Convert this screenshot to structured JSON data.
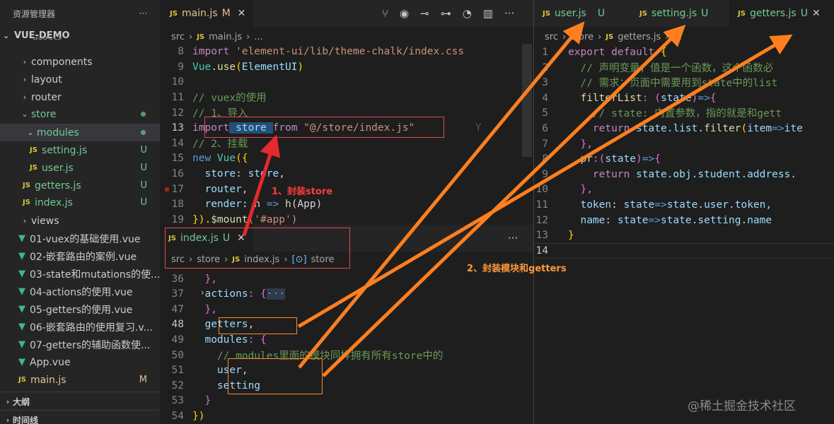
{
  "sidebar": {
    "header": "资源管理器",
    "more": "···",
    "project": "VUE-DEMO",
    "rows": [
      {
        "label": "assets",
        "badge": ""
      },
      {
        "label": "components",
        "badge": ""
      },
      {
        "label": "layout",
        "badge": ""
      },
      {
        "label": "router",
        "badge": ""
      },
      {
        "label": "store",
        "badge": ""
      },
      {
        "label": "modules",
        "badge": ""
      },
      {
        "label": "setting.js",
        "badge": "U"
      },
      {
        "label": "user.js",
        "badge": "U"
      },
      {
        "label": "getters.js",
        "badge": "U"
      },
      {
        "label": "index.js",
        "badge": "U"
      },
      {
        "label": "views",
        "badge": ""
      },
      {
        "label": "01-vuex的基础使用.vue",
        "badge": ""
      },
      {
        "label": "02-嵌套路由的案例.vue",
        "badge": ""
      },
      {
        "label": "03-state和mutations的使...",
        "badge": ""
      },
      {
        "label": "04-actions的使用.vue",
        "badge": ""
      },
      {
        "label": "05-getters的使用.vue",
        "badge": ""
      },
      {
        "label": "06-嵌套路由的使用复习.v...",
        "badge": ""
      },
      {
        "label": "07-getters的辅助函数使...",
        "badge": ""
      },
      {
        "label": "App.vue",
        "badge": ""
      },
      {
        "label": "main.js",
        "badge": "M"
      }
    ],
    "outline": "大纲",
    "timeline": "时间线"
  },
  "left_editor": {
    "tab": {
      "icon": "JS",
      "name": "main.js",
      "status": "M",
      "close": "✕"
    },
    "breadcrumb": [
      "src",
      "main.js",
      "..."
    ],
    "lines": [
      {
        "n": "8"
      },
      {
        "n": "9"
      },
      {
        "n": "10"
      },
      {
        "n": "11"
      },
      {
        "n": "12"
      },
      {
        "n": "13"
      },
      {
        "n": "14"
      },
      {
        "n": "15"
      },
      {
        "n": "16"
      },
      {
        "n": "17"
      },
      {
        "n": "18"
      },
      {
        "n": "19"
      }
    ],
    "code": {
      "l8a": "import",
      "l8b": " 'element-ui/lib/theme-chalk/index.css",
      "l9a": "Vue",
      "l9b": ".",
      "l9c": "use",
      "l9d": "(",
      "l9e": "ElementUI",
      "l9f": ")",
      "l11": "// vuex的使用",
      "l12": "// 1、导入",
      "l13a": "import",
      "l13b": " store ",
      "l13c": "from",
      "l13d": " \"@/store/index.js\"",
      "l13e": "Y",
      "l14": "// 2、挂载",
      "l15a": "new",
      "l15b": " Vue",
      "l15c": "({",
      "l16a": "  store",
      "l16b": ": ",
      "l16c": "store",
      "l16d": ",",
      "l17a": "  router",
      "l17b": ", ",
      "l18a": "  render",
      "l18b": ": h ",
      "l18c": "=>",
      "l18d": " h",
      "l18e": "(App)",
      "l19a": "}).",
      "l19b": "$mount",
      "l19c": "('#app')"
    }
  },
  "bottom_editor": {
    "tab": {
      "icon": "JS",
      "name": "index.js",
      "status": "U",
      "close": "✕"
    },
    "more": "···",
    "breadcrumb": [
      "src",
      "store",
      "index.js",
      "store"
    ],
    "lines": [
      {
        "n": "36"
      },
      {
        "n": "37"
      },
      {
        "n": "47"
      },
      {
        "n": "48"
      },
      {
        "n": "49"
      },
      {
        "n": "50"
      },
      {
        "n": "51"
      },
      {
        "n": "52"
      },
      {
        "n": "53"
      },
      {
        "n": "54"
      }
    ],
    "code": {
      "l36": "  },",
      "l37a": "  actions",
      "l37b": ": {",
      "l37c": "···",
      "l47": "  },",
      "l48a": "  getters",
      "l48b": ",",
      "l49a": "  modules",
      "l49b": ": {",
      "l50": "    // modules里面的模块同样拥有所有store中的",
      "l51a": "    user",
      "l51b": ",",
      "l52": "    setting",
      "l53": "  }",
      "l54": "})"
    }
  },
  "right_editor": {
    "tabs": [
      {
        "icon": "JS",
        "name": "user.js",
        "status": "U"
      },
      {
        "icon": "JS",
        "name": "setting.js",
        "status": "U"
      },
      {
        "icon": "JS",
        "name": "getters.js",
        "status": "U",
        "close": "✕"
      }
    ],
    "breadcrumb": [
      "src",
      "store",
      "getters.js",
      "..."
    ],
    "lines": [
      {
        "n": "1"
      },
      {
        "n": "2"
      },
      {
        "n": "3"
      },
      {
        "n": "4"
      },
      {
        "n": "5"
      },
      {
        "n": "6"
      },
      {
        "n": "7"
      },
      {
        "n": "8"
      },
      {
        "n": "9"
      },
      {
        "n": "10"
      },
      {
        "n": "11"
      },
      {
        "n": "12"
      },
      {
        "n": "13"
      },
      {
        "n": "14"
      }
    ],
    "code": {
      "l1a": "export",
      "l1b": " default",
      "l1c": " {",
      "l2": "  // 声明变量，值是一个函数，这个函数必",
      "l3": "  // 需求：页面中需要用到state中的list",
      "l4a": "  filterList",
      "l4b": ": (",
      "l4c": "state",
      "l4d": ")",
      "l4e": "=>",
      "l4f": "{",
      "l5": "    // state: 内置参数，指的就是和gett",
      "l6a": "    return",
      "l6b": " state",
      "l6c": ".",
      "l6d": "list",
      "l6e": ".",
      "l6f": "filter",
      "l6g": "(",
      "l6h": "item",
      "l6i": "=>",
      "l6j": "ite",
      "l7": "  },",
      "l8a": "  pr",
      "l8b": ":(",
      "l8c": "state",
      "l8d": ")",
      "l8e": "=>",
      "l8f": "{",
      "l9a": "    return",
      "l9b": " state.obj.student.address.",
      "l10": "  },",
      "l11a": "  token",
      "l11b": ": ",
      "l11c": "state",
      "l11d": "=>",
      "l11e": "state.user.token,",
      "l12a": "  name",
      "l12b": ": ",
      "l12c": "state",
      "l12d": "=>",
      "l12e": "state.setting.name",
      "l13": "}"
    }
  },
  "annotations": {
    "note1": "1、封装store",
    "note2": "2、封装模块和getters",
    "watermark": "@稀土掘金技术社区"
  },
  "colors": {
    "arrow_orange": "#ff7f1f",
    "arrow_red": "#e5292c",
    "box_red": "#e5484d"
  }
}
